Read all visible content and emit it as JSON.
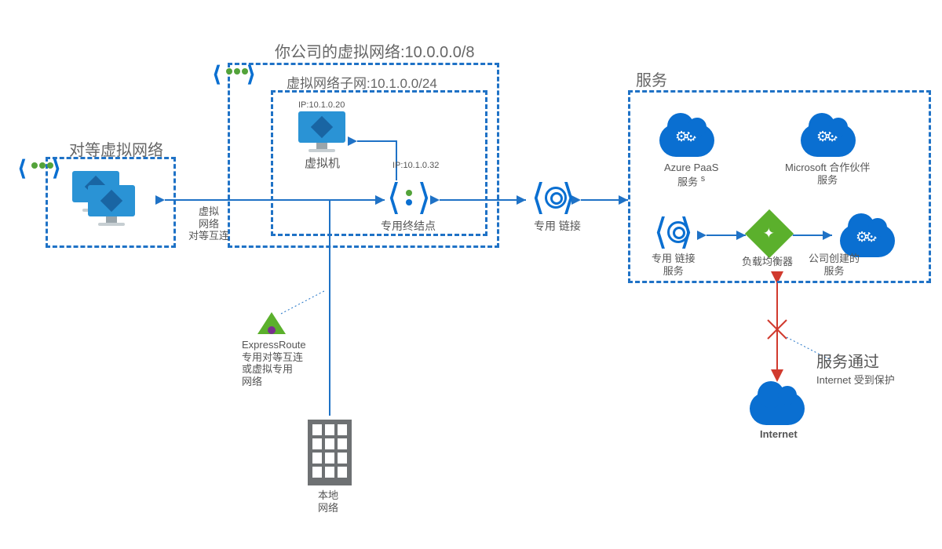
{
  "titles": {
    "company_vnet": "你公司的虚拟网络:10.0.0.0/8",
    "subnet": "虚拟网络子网:10.1.0.0/24",
    "peered_vnet": "对等虚拟网络",
    "services": "服务"
  },
  "nodes": {
    "vm": {
      "label": "虚拟机",
      "ip": "IP:10.1.0.20"
    },
    "private_endpoint": {
      "label": "专用终结点",
      "ip": "IP:10.1.0.32"
    },
    "private_link": {
      "label": "专用 链接"
    },
    "peering_edge": {
      "line1": "虚拟",
      "line2": "网络",
      "line3": "对等互连"
    },
    "azure_paas": {
      "line1": "Azure PaaS",
      "line2": "服务",
      "super": "s"
    },
    "partner": {
      "line1": "Microsoft 合作伙伴",
      "line2": "服务"
    },
    "pls": {
      "line1": "专用 链接",
      "line2": "服务"
    },
    "lb": {
      "label": "负载均衡器"
    },
    "company_svc": {
      "line1": "公司创建的",
      "line2": "服务"
    },
    "internet": {
      "label": "Internet"
    },
    "internet_note": {
      "line1": "服务通过",
      "line2": "Internet 受到保护"
    },
    "expressroute": {
      "label": "ExpressRoute",
      "sub1": "专用对等互连",
      "sub2": "或虚拟专用",
      "sub3": "网络"
    },
    "onprem": {
      "line1": "本地",
      "line2": "网络"
    }
  },
  "marker_color": "#1f72c6",
  "red": "#d13a2e"
}
